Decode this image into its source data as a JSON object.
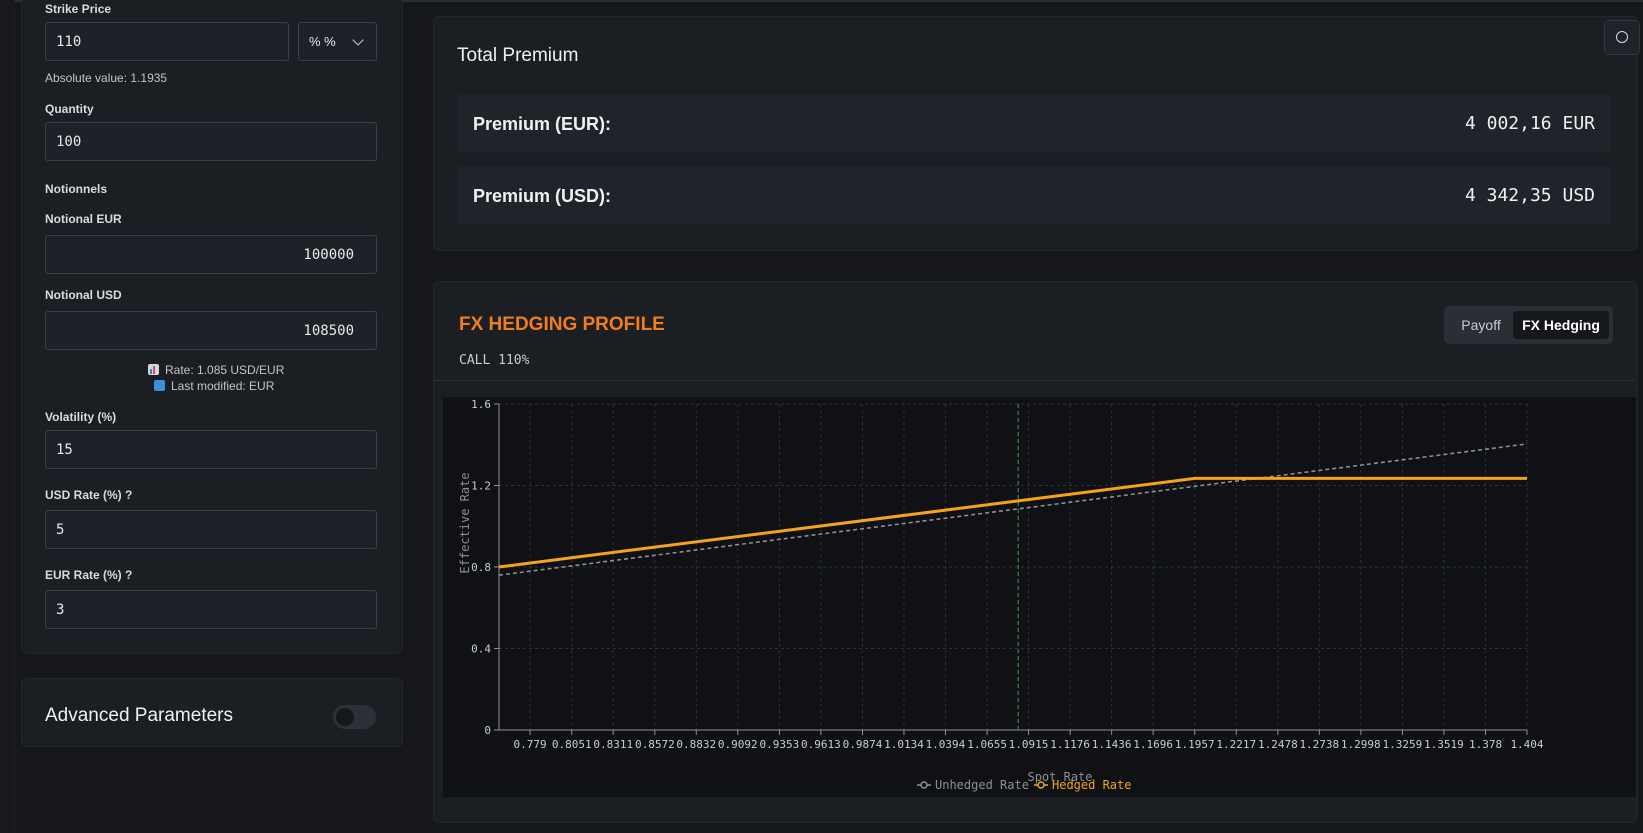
{
  "left": {
    "strike_label": "Strike Price",
    "strike_value": "110",
    "strike_unit": "% %",
    "absolute_value": "Absolute value: 1.1935",
    "quantity_label": "Quantity",
    "quantity_value": "100",
    "notionnels_label": "Notionnels",
    "notional_eur_label": "Notional EUR",
    "notional_eur_value": "100000",
    "notional_usd_label": "Notional USD",
    "notional_usd_value": "108500",
    "rate_text": "Rate: 1.085 USD/EUR",
    "last_modified": "Last modified: EUR",
    "volatility_label": "Volatility (%)",
    "volatility_value": "15",
    "usd_rate_label": "USD Rate (%) ?",
    "usd_rate_value": "5",
    "eur_rate_label": "EUR Rate (%) ?",
    "eur_rate_value": "3",
    "advanced_label": "Advanced Parameters",
    "advanced_enabled": false
  },
  "premium": {
    "title": "Total Premium",
    "eur_label": "Premium (EUR):",
    "eur_value": "4 002,16 EUR",
    "usd_label": "Premium (USD):",
    "usd_value": "4 342,35 USD"
  },
  "profile": {
    "title": "FX HEDGING PROFILE",
    "subtitle": "CALL 110%",
    "tabs": [
      "Payoff",
      "FX Hedging"
    ],
    "active_tab": "FX Hedging"
  },
  "colors": {
    "accent_orange": "#f07d1e",
    "hedged_line": "#f5a31a",
    "unhedged_line": "#8c8f94",
    "spot_marker": "#2fa84f"
  },
  "chart_data": {
    "type": "line",
    "xlabel": "Spot Rate",
    "ylabel": "Effective Rate",
    "x_ticks": [
      "0.779",
      "0.8051",
      "0.8311",
      "0.8572",
      "0.8832",
      "0.9092",
      "0.9353",
      "0.9613",
      "0.9874",
      "1.0134",
      "1.0394",
      "1.0655",
      "1.0915",
      "1.1176",
      "1.1436",
      "1.1696",
      "1.1957",
      "1.2217",
      "1.2478",
      "1.2738",
      "1.2998",
      "1.3259",
      "1.3519",
      "1.378",
      "1.404"
    ],
    "y_ticks": [
      "0",
      "0.4",
      "0.8",
      "1.2",
      "1.6"
    ],
    "xlim": [
      0.7595,
      1.404
    ],
    "ylim": [
      0,
      1.6
    ],
    "spot_marker_x": 1.085,
    "grid": true,
    "legend_position": "bottom",
    "series": [
      {
        "name": "Unhedged Rate",
        "style": "dashed",
        "x": [
          0.7595,
          1.404
        ],
        "y": [
          0.76,
          1.404
        ]
      },
      {
        "name": "Hedged Rate",
        "style": "solid",
        "x": [
          0.7595,
          1.1957,
          1.404
        ],
        "y": [
          0.8,
          1.235,
          1.235
        ]
      }
    ]
  }
}
